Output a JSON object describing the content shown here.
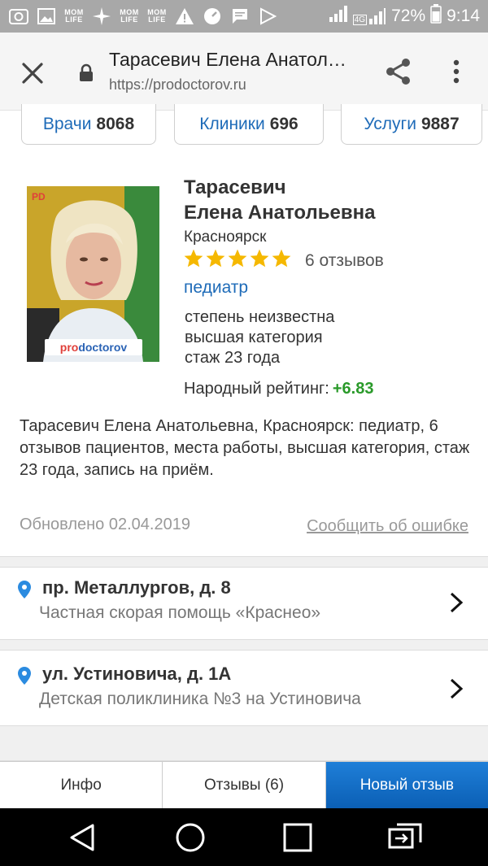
{
  "status_bar": {
    "battery": "72%",
    "time": "9:14",
    "network": "4G",
    "mom_icon_text": "MOM\nLIFE"
  },
  "browser": {
    "page_title": "Тарасевич Елена Анатольевна",
    "url": "https://prodoctorov.ru"
  },
  "stat_tabs": [
    {
      "label": "Врачи",
      "count": "8068"
    },
    {
      "label": "Клиники",
      "count": "696"
    },
    {
      "label": "Услуги",
      "count": "9887"
    }
  ],
  "doctor": {
    "name_line1": "Тарасевич",
    "name_line2": "Елена Анатольевна",
    "city": "Красноярск",
    "stars": 5,
    "reviews": "6 отзывов",
    "specialty": "педиатр",
    "degree": "степень неизвестна",
    "category": "высшая категория",
    "experience": "стаж 23 года",
    "rating_label": "Народный рейтинг:",
    "rating_value": "+6.83",
    "photo_logo_pro": "pro",
    "photo_logo_doctorov": "doctorov",
    "photo_mark": "PD"
  },
  "description": "Тарасевич Елена Анатольевна, Красноярск: педиатр, 6 отзывов пациентов, места работы, высшая категория, стаж 23 года, запись на приём.",
  "updated": "Обновлено 02.04.2019",
  "report_error": "Сообщить об ошибке",
  "addresses": [
    {
      "title": "пр. Металлургов, д. 8",
      "clinic": "Частная скорая помощь «Краснео»"
    },
    {
      "title": "ул. Устиновича, д. 1А",
      "clinic": "Детская поликлиника №3 на Устиновича"
    }
  ],
  "bottom_tabs": {
    "info": "Инфо",
    "reviews": "Отзывы (6)",
    "new_review": "Новый отзыв"
  },
  "colors": {
    "link_blue": "#1e6bb8",
    "rating_green": "#2a9a2a",
    "star_gold": "#f5b800",
    "primary_button": "#0b5fb5"
  }
}
